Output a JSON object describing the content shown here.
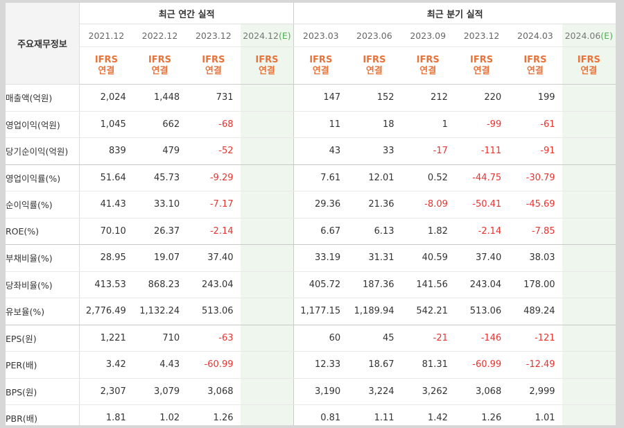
{
  "header": {
    "corner": "주요재무정보",
    "annual_title": "최근 연간 실적",
    "quarter_title": "최근 분기 실적",
    "annual_periods": [
      "2021.12",
      "2022.12",
      "2023.12"
    ],
    "annual_estimate": {
      "period": "2024.12",
      "flag": "(E)"
    },
    "quarter_periods": [
      "2023.03",
      "2023.06",
      "2023.09",
      "2023.12",
      "2024.03"
    ],
    "quarter_estimate": {
      "period": "2024.06",
      "flag": "(E)"
    },
    "basis_line1": "IFRS",
    "basis_line2": "연결"
  },
  "rows": [
    {
      "label": "매출액(억원)",
      "annual": [
        "2,024",
        "1,448",
        "731"
      ],
      "quarter": [
        "147",
        "152",
        "212",
        "220",
        "199"
      ]
    },
    {
      "label": "영업이익(억원)",
      "annual": [
        "1,045",
        "662",
        "-68"
      ],
      "quarter": [
        "11",
        "18",
        "1",
        "-99",
        "-61"
      ]
    },
    {
      "label": "당기순이익(억원)",
      "annual": [
        "839",
        "479",
        "-52"
      ],
      "quarter": [
        "43",
        "33",
        "-17",
        "-111",
        "-91"
      ]
    },
    {
      "label": "영업이익률(%)",
      "annual": [
        "51.64",
        "45.73",
        "-9.29"
      ],
      "quarter": [
        "7.61",
        "12.01",
        "0.52",
        "-44.75",
        "-30.79"
      ]
    },
    {
      "label": "순이익률(%)",
      "annual": [
        "41.43",
        "33.10",
        "-7.17"
      ],
      "quarter": [
        "29.36",
        "21.36",
        "-8.09",
        "-50.41",
        "-45.69"
      ]
    },
    {
      "label": "ROE(%)",
      "annual": [
        "70.10",
        "26.37",
        "-2.14"
      ],
      "quarter": [
        "6.67",
        "6.13",
        "1.82",
        "-2.14",
        "-7.85"
      ]
    },
    {
      "label": "부채비율(%)",
      "annual": [
        "28.95",
        "19.07",
        "37.40"
      ],
      "quarter": [
        "33.19",
        "31.31",
        "40.59",
        "37.40",
        "38.03"
      ]
    },
    {
      "label": "당좌비율(%)",
      "annual": [
        "413.53",
        "868.23",
        "243.04"
      ],
      "quarter": [
        "405.72",
        "187.36",
        "141.56",
        "243.04",
        "178.00"
      ]
    },
    {
      "label": "유보율(%)",
      "annual": [
        "2,776.49",
        "1,132.24",
        "513.06"
      ],
      "quarter": [
        "1,177.15",
        "1,189.94",
        "542.21",
        "513.06",
        "489.24"
      ]
    },
    {
      "label": "EPS(원)",
      "annual": [
        "1,221",
        "710",
        "-63"
      ],
      "quarter": [
        "60",
        "45",
        "-21",
        "-146",
        "-121"
      ]
    },
    {
      "label": "PER(배)",
      "annual": [
        "3.42",
        "4.43",
        "-60.99"
      ],
      "quarter": [
        "12.33",
        "18.67",
        "81.31",
        "-60.99",
        "-12.49"
      ]
    },
    {
      "label": "BPS(원)",
      "annual": [
        "2,307",
        "3,079",
        "3,068"
      ],
      "quarter": [
        "3,190",
        "3,224",
        "3,262",
        "3,068",
        "2,999"
      ]
    },
    {
      "label": "PBR(배)",
      "annual": [
        "1.81",
        "1.02",
        "1.26"
      ],
      "quarter": [
        "0.81",
        "1.11",
        "1.42",
        "1.26",
        "1.01"
      ]
    }
  ],
  "colors": {
    "negative": "#e8332f",
    "basis": "#e8733a",
    "estimate_bg": "#eef6ee",
    "estimate_flag": "#4caf50"
  }
}
